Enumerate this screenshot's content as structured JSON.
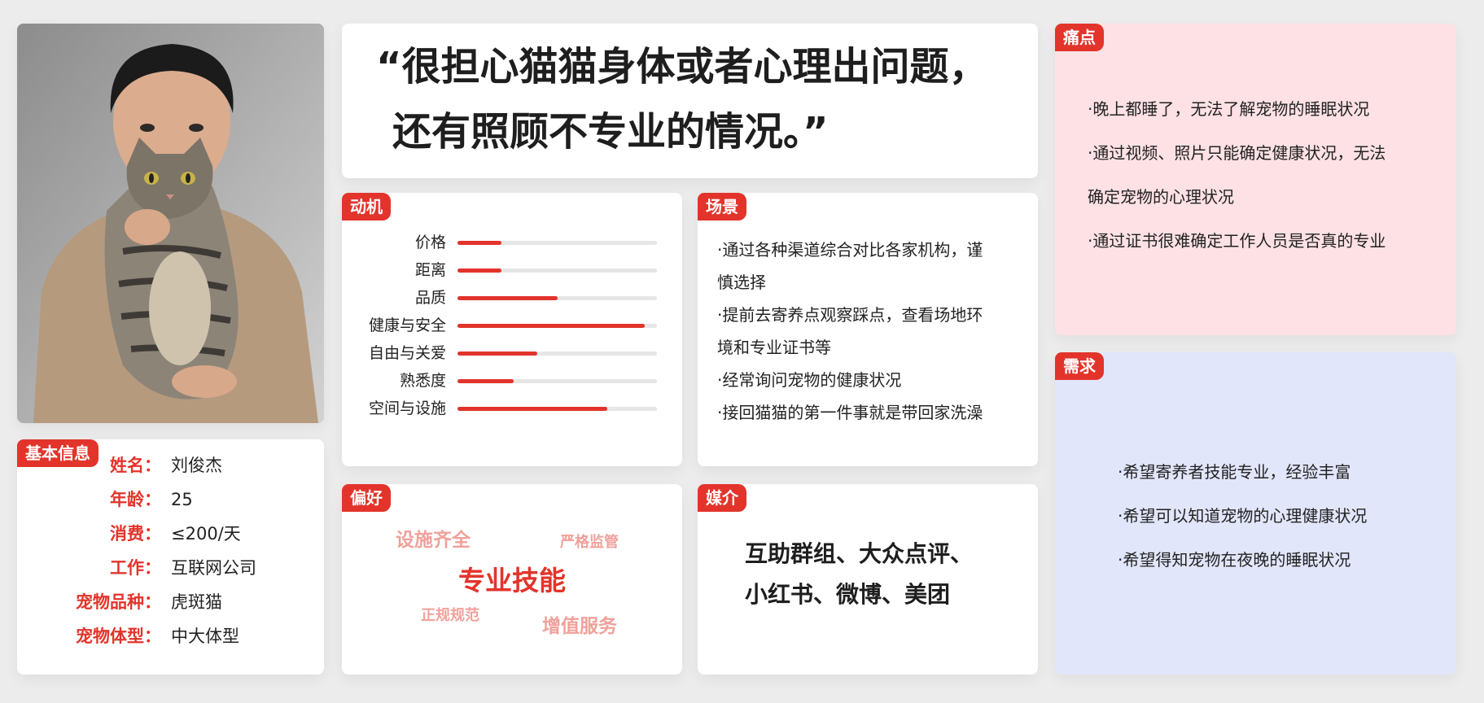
{
  "basic": {
    "tag": "基本信息",
    "rows": [
      {
        "label": "姓名：",
        "value": "刘俊杰"
      },
      {
        "label": "年龄：",
        "value": "25"
      },
      {
        "label": "消费：",
        "value": "≤200/天"
      },
      {
        "label": "工作：",
        "value": "互联网公司"
      },
      {
        "label": "宠物品种：",
        "value": "虎斑猫"
      },
      {
        "label": "宠物体型：",
        "value": "中大体型"
      }
    ]
  },
  "quote": {
    "line1": "“很担心猫猫身体或者心理出问题，",
    "line2": "还有照顾不专业的情况。”"
  },
  "motivation": {
    "tag": "动机",
    "bars": [
      {
        "label": "价格",
        "value": 0.22
      },
      {
        "label": "距离",
        "value": 0.22
      },
      {
        "label": "品质",
        "value": 0.5
      },
      {
        "label": "健康与安全",
        "value": 0.94
      },
      {
        "label": "自由与关爱",
        "value": 0.4
      },
      {
        "label": "熟悉度",
        "value": 0.28
      },
      {
        "label": "空间与设施",
        "value": 0.75
      }
    ]
  },
  "scene": {
    "tag": "场景",
    "lines": [
      "·通过各种渠道综合对比各家机构，谨",
      "慎选择",
      "·提前去寄养点观察踩点，查看场地环",
      "境和专业证书等",
      "·经常询问宠物的健康状况",
      "·接回猫猫的第一件事就是带回家洗澡"
    ]
  },
  "pain": {
    "tag": "痛点",
    "lines": [
      "·晚上都睡了，无法了解宠物的睡眠状况",
      "·通过视频、照片只能确定健康状况，无法",
      "确定宠物的心理状况",
      "·通过证书很难确定工作人员是否真的专业"
    ]
  },
  "need": {
    "tag": "需求",
    "lines": [
      "·希望寄养者技能专业，经验丰富",
      "·希望可以知道宠物的心理健康状况",
      "·希望得知宠物在夜晚的睡眠状况"
    ]
  },
  "preference": {
    "tag": "偏好",
    "words": [
      "设施齐全",
      "严格监管",
      "专业技能",
      "正规规范",
      "增值服务"
    ]
  },
  "media": {
    "tag": "媒介",
    "line1": "互助群组、大众点评、",
    "line2": "小红书、微博、美团"
  },
  "colors": {
    "accent": "#e2342b",
    "pain_bg": "#fde1e5",
    "need_bg": "#e2e6fb",
    "word_light": "#f0a19b"
  }
}
